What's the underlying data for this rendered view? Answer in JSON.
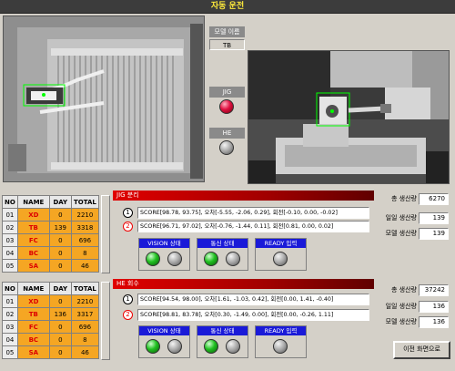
{
  "title": "자동 운전",
  "model_panel": {
    "label": "모델 이름",
    "value": "TB",
    "jig_label": "JIG",
    "he_label": "HE"
  },
  "table1": {
    "headers": [
      "NO",
      "NAME",
      "DAY",
      "TOTAL"
    ],
    "rows": [
      {
        "no": "01",
        "name": "XD",
        "day": "0",
        "total": "2210"
      },
      {
        "no": "02",
        "name": "TB",
        "day": "139",
        "total": "3318"
      },
      {
        "no": "03",
        "name": "FC",
        "day": "0",
        "total": "696"
      },
      {
        "no": "04",
        "name": "BC",
        "day": "0",
        "total": "8"
      },
      {
        "no": "05",
        "name": "SA",
        "day": "0",
        "total": "46"
      }
    ]
  },
  "table2": {
    "headers": [
      "NO",
      "NAME",
      "DAY",
      "TOTAL"
    ],
    "rows": [
      {
        "no": "01",
        "name": "XD",
        "day": "0",
        "total": "2210"
      },
      {
        "no": "02",
        "name": "TB",
        "day": "136",
        "total": "3317"
      },
      {
        "no": "03",
        "name": "FC",
        "day": "0",
        "total": "696"
      },
      {
        "no": "04",
        "name": "BC",
        "day": "0",
        "total": "8"
      },
      {
        "no": "05",
        "name": "SA",
        "day": "0",
        "total": "46"
      }
    ]
  },
  "jig": {
    "header": "JIG 분리",
    "score1_num": "1",
    "score1": "SCORE[98.78, 93.75], 오차[-5.55, -2.06, 0.29], 회전[-0.10, 0.00, -0.02]",
    "score2_num": "2",
    "score2": "SCORE[96.71, 97.02], 오차[-0.76, -1.44, 0.11], 회전[0.81, 0.00, 0.02]",
    "vision_label": "VISION 상태",
    "comm_label": "통신 상태",
    "ready_label": "READY 입력",
    "stats": [
      {
        "label": "총 생산량",
        "value": "6270"
      },
      {
        "label": "일일 생산량",
        "value": "139"
      },
      {
        "label": "모델 생산량",
        "value": "139"
      }
    ]
  },
  "he": {
    "header": "HE 회수",
    "score1_num": "1",
    "score1": "SCORE[94.54, 98.00], 오차[1.61, -1.03, 0.42], 회전[0.00, 1.41, -0.40]",
    "score2_num": "2",
    "score2": "SCORE[98.81, 83.78], 오차[0.30, -1.49, 0.00], 회전[0.00, -0.26, 1.11]",
    "vision_label": "VISION 상태",
    "comm_label": "통신 상태",
    "ready_label": "READY 입력",
    "stats": [
      {
        "label": "총 생산량",
        "value": "37242"
      },
      {
        "label": "일일 생산량",
        "value": "136"
      },
      {
        "label": "모델 생산량",
        "value": "136"
      }
    ]
  },
  "back_button": "이전 화면으로",
  "colors": {
    "accent_red": "#e00000",
    "status_blue": "#1a1ad8",
    "row_orange": "#f5a623",
    "lamp_green": "#20c020",
    "lamp_red": "#e01040"
  }
}
